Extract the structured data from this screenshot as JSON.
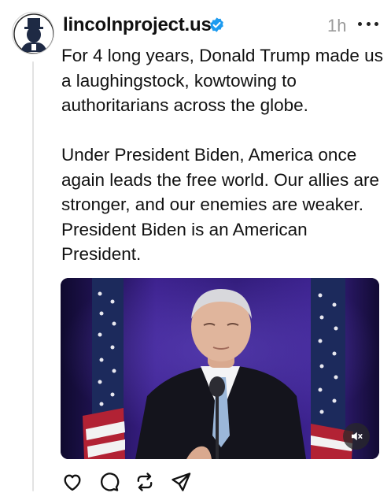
{
  "post": {
    "username": "lincolnproject.us",
    "verified": true,
    "time": "1h",
    "text": "For 4 long years, Donald Trump made us a laughingstock, kowtowing to authoritarians across the globe.\n\nUnder President Biden, America once again leads the free world. Our allies are stronger, and our enemies are weaker. President Biden is an American President.",
    "media": {
      "type": "video",
      "muted": true
    }
  },
  "icons": {
    "avatar": "lincoln-silhouette-avatar",
    "verified": "verified-badge-icon",
    "more": "more-options-icon",
    "mute": "volume-muted-icon",
    "like": "heart-icon",
    "reply": "comment-bubble-icon",
    "repost": "repost-icon",
    "share": "send-icon"
  },
  "colors": {
    "verified": "#1d9bf0",
    "secondary_text": "#9a9a9a",
    "thread_line": "#e3e3e3"
  }
}
